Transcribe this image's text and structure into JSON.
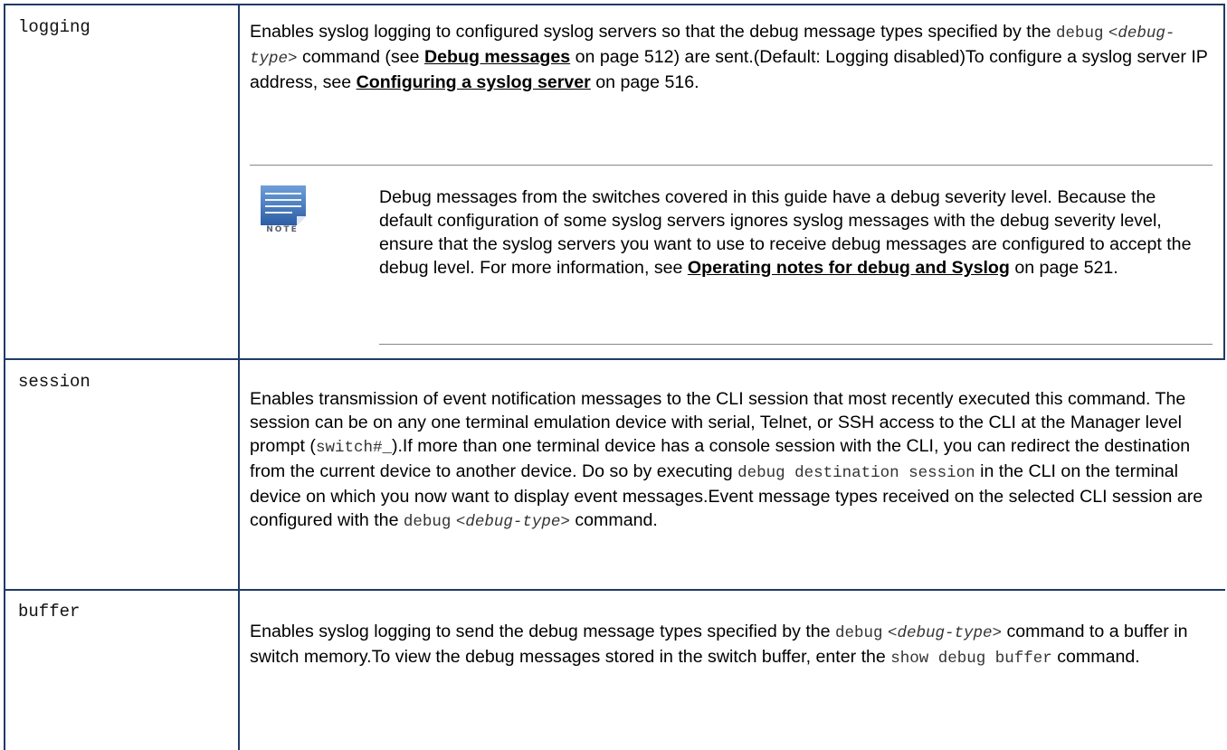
{
  "rows": [
    {
      "term": "logging",
      "desc": {
        "t1": "Enables syslog logging to configured syslog servers so that the debug message types specified by the ",
        "code1": "debug",
        "code2": "<debug-type>",
        "t2": " command (see ",
        "link1": "Debug messages",
        "t3": " on page 512) are sent.(Default: Logging disabled)To configure a syslog server IP address, see ",
        "link2": "Configuring a syslog server",
        "t4": " on page 516."
      },
      "note": {
        "icon_label": "NOTE",
        "t1": "Debug messages from the switches covered in this guide have a debug severity level. Because the default configuration of some syslog servers ignores syslog messages with the debug severity level, ensure that the syslog servers you want to use to receive debug messages are configured to accept the debug level. For more information, see ",
        "link": "Operating notes for debug and Syslog",
        "t2": " on page 521."
      }
    },
    {
      "term": "session",
      "desc": {
        "t1": "Enables transmission of event notification messages to the CLI session that most recently executed this command. The session can be on any one terminal emulation device with serial, Telnet, or SSH access to the CLI at the Manager level prompt (",
        "code1": "switch#_",
        "t2": ").If more than one terminal device has a console session with the CLI, you can redirect the destination from the current device to another device. Do so by executing ",
        "code2": "debug destination session",
        "t3": " in the CLI on the terminal device on which you now want to display event messages.Event message types received on the selected CLI session are configured with the ",
        "code3": "debug",
        "code4": "<debug-type>",
        "t4": " command."
      }
    },
    {
      "term": "buffer",
      "desc": {
        "t1": "Enables syslog logging to send the debug message types specified by the ",
        "code1": "debug",
        "code2": "<debug-type>",
        "t2": " command to a buffer in switch memory.To view the debug messages stored in the switch buffer, enter the ",
        "code3": "show debug buffer",
        "t3": " command."
      }
    }
  ]
}
